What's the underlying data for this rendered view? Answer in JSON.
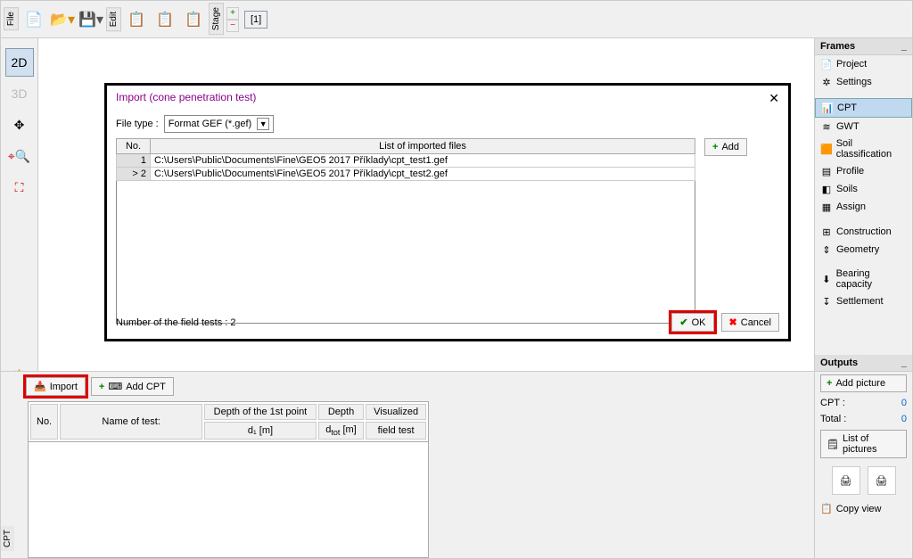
{
  "toolbar": {
    "file_tab": "File",
    "edit_tab": "Edit",
    "stage_tab": "Stage",
    "stage_num": "[1]"
  },
  "left_tools": {
    "d2": "2D",
    "d3": "3D"
  },
  "dialog": {
    "title": "Import (cone penetration test)",
    "file_type_label": "File type :",
    "file_type_value": "Format GEF (*.gef)",
    "th_no": "No.",
    "th_list": "List of imported files",
    "rows": [
      {
        "n": "1",
        "path": "C:\\Users\\Public\\Documents\\Fine\\GEO5 2017 Příklady\\cpt_test1.gef"
      },
      {
        "n": "2",
        "path": "C:\\Users\\Public\\Documents\\Fine\\GEO5 2017 Příklady\\cpt_test2.gef"
      }
    ],
    "add": "Add",
    "count_label": "Number of the field tests : 2",
    "ok": "OK",
    "cancel": "Cancel"
  },
  "bottom": {
    "import": "Import",
    "add_cpt": "Add CPT",
    "th_no": "No.",
    "th_name": "Name of test:",
    "th_depth1": "Depth of the 1st point",
    "th_depth1_sub": "d₁ [m]",
    "th_depth": "Depth",
    "th_depth_sub": "dtot [m]",
    "th_vis": "Visualized",
    "th_vis_sub": "field test",
    "cpt_tab": "CPT"
  },
  "frames": {
    "header": "Frames",
    "items": [
      {
        "label": "Project",
        "ico": "📄"
      },
      {
        "label": "Settings",
        "ico": "✲"
      },
      {
        "label": "CPT",
        "ico": "📊",
        "active": true,
        "spacer": true
      },
      {
        "label": "GWT",
        "ico": "≋"
      },
      {
        "label": "Soil classification",
        "ico": "🟧"
      },
      {
        "label": "Profile",
        "ico": "▤"
      },
      {
        "label": "Soils",
        "ico": "◧"
      },
      {
        "label": "Assign",
        "ico": "▦"
      },
      {
        "label": "Construction",
        "ico": "⊞",
        "spacer": true
      },
      {
        "label": "Geometry",
        "ico": "⇕"
      },
      {
        "label": "Bearing capacity",
        "ico": "⬇",
        "spacer": true
      },
      {
        "label": "Settlement",
        "ico": "↧"
      }
    ]
  },
  "outputs": {
    "header": "Outputs",
    "add_picture": "Add picture",
    "cpt_label": "CPT :",
    "cpt_val": "0",
    "total_label": "Total :",
    "total_val": "0",
    "list": "List of pictures",
    "copy": "Copy view"
  }
}
